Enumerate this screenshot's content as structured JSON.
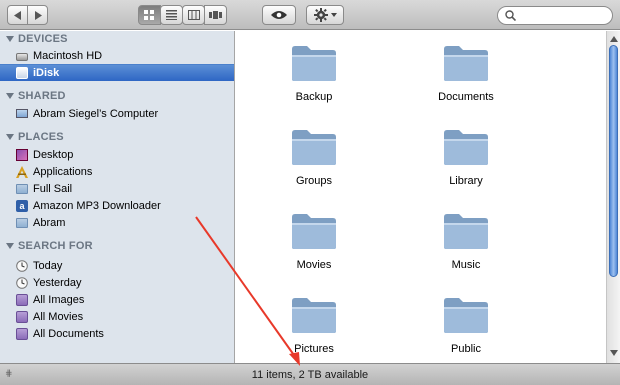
{
  "toolbar": {
    "back_icon": "back-arrow-icon",
    "forward_icon": "forward-arrow-icon",
    "view_icons": [
      "icon-view-icon",
      "list-view-icon",
      "column-view-icon",
      "coverflow-view-icon"
    ],
    "quicklook_icon": "eye-icon",
    "action_icon": "gear-icon",
    "search": {
      "placeholder": "",
      "value": ""
    }
  },
  "sidebar": {
    "sections": [
      {
        "header": "DEVICES",
        "items": [
          {
            "label": "Macintosh HD",
            "icon": "hard-drive-icon"
          },
          {
            "label": "iDisk",
            "icon": "idisk-icon",
            "selected": true
          }
        ]
      },
      {
        "header": "SHARED",
        "items": [
          {
            "label": "Abram Siegel’s Computer",
            "icon": "computer-icon"
          }
        ]
      },
      {
        "header": "PLACES",
        "items": [
          {
            "label": "Desktop",
            "icon": "desktop-icon"
          },
          {
            "label": "Applications",
            "icon": "applications-icon"
          },
          {
            "label": "Full Sail",
            "icon": "folder-icon"
          },
          {
            "label": "Amazon MP3 Downloader",
            "icon": "amazon-icon"
          },
          {
            "label": "Abram",
            "icon": "folder-icon"
          }
        ]
      },
      {
        "header": "SEARCH FOR",
        "items": [
          {
            "label": "Today",
            "icon": "clock-icon"
          },
          {
            "label": "Yesterday",
            "icon": "clock-icon"
          },
          {
            "label": "All Images",
            "icon": "smart-folder-icon"
          },
          {
            "label": "All Movies",
            "icon": "smart-folder-icon"
          },
          {
            "label": "All Documents",
            "icon": "smart-folder-icon"
          }
        ]
      }
    ]
  },
  "content": {
    "folders": [
      "Backup",
      "Documents",
      "Groups",
      "Library",
      "Movies",
      "Music",
      "Pictures",
      "Public"
    ]
  },
  "status": {
    "text": "11 items, 2 TB available"
  },
  "colors": {
    "sidebar_bg": "#dde4ec",
    "selection": "#2e66c4",
    "folder": "#8fb0d2",
    "annotation_arrow": "#e8392a"
  }
}
